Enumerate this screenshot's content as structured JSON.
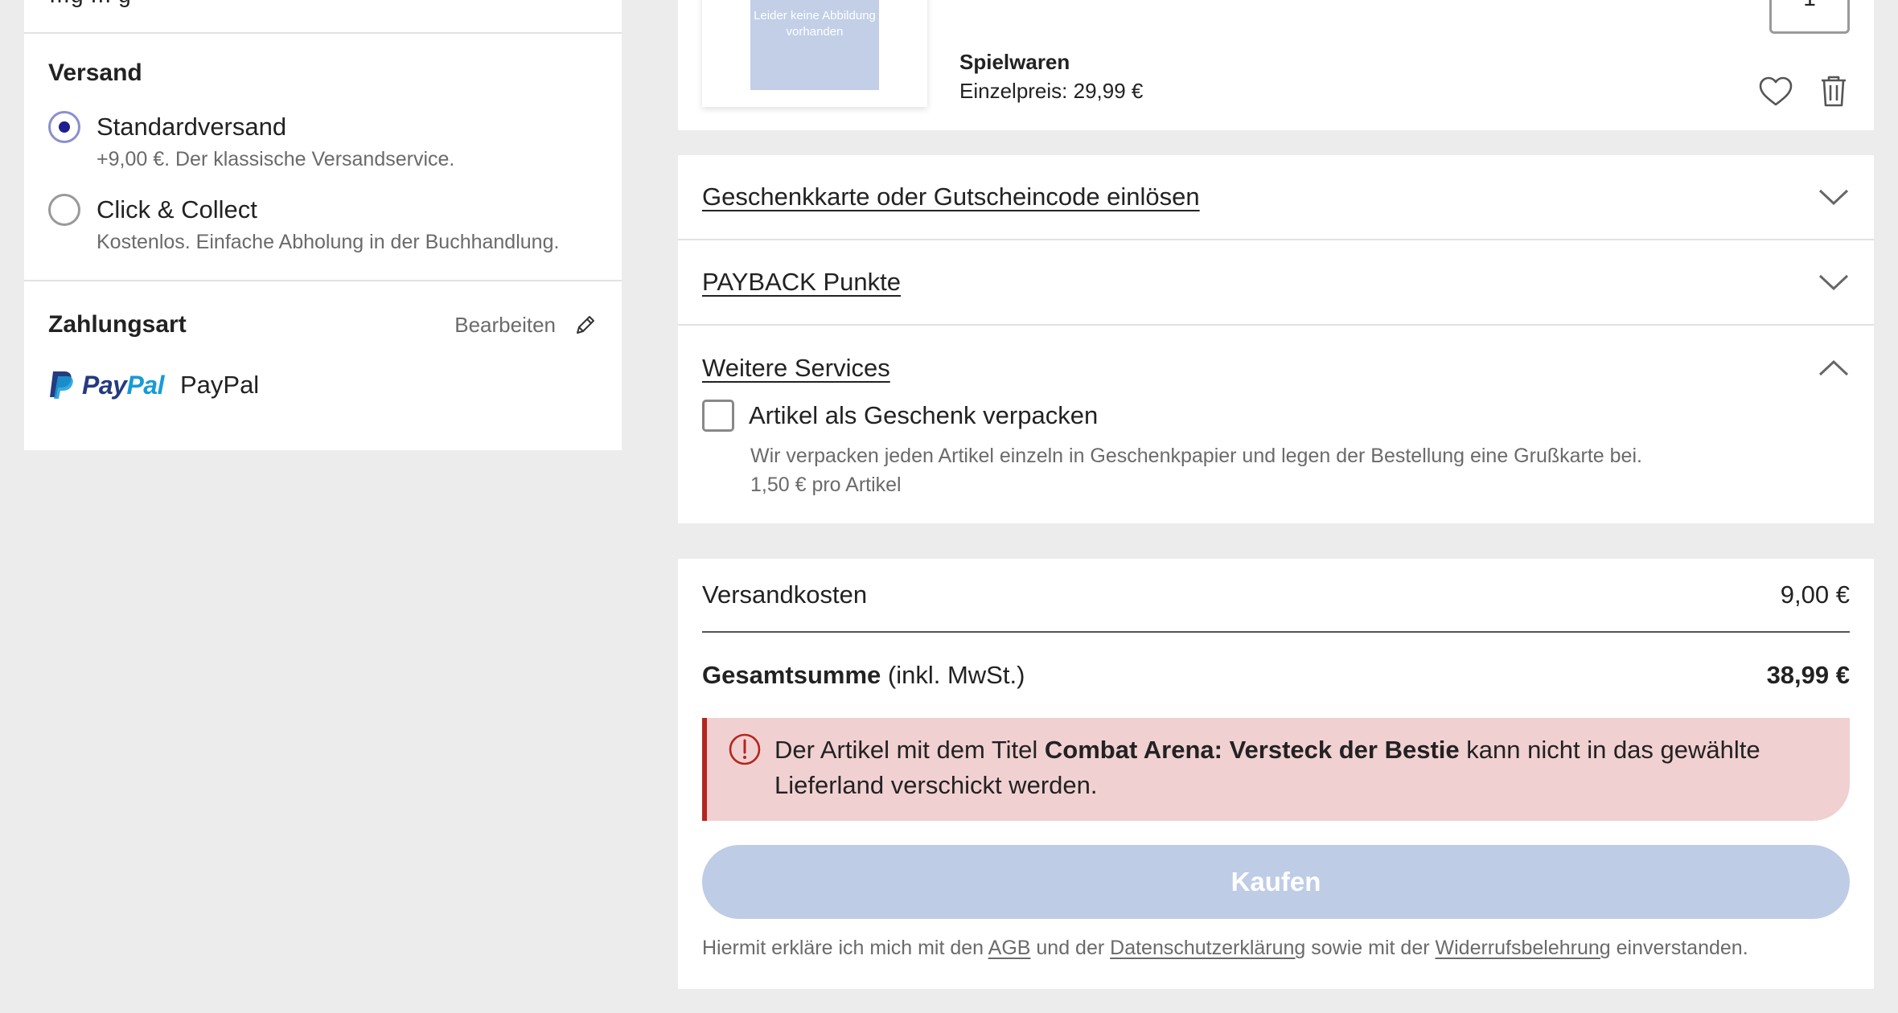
{
  "left": {
    "cut_text": "…g … g",
    "shipping": {
      "title": "Versand",
      "options": [
        {
          "label": "Standardversand",
          "description": "+9,00 €. Der klassische Versandservice.",
          "selected": true
        },
        {
          "label": "Click & Collect",
          "description": "Kostenlos. Einfache Abholung in der Buchhandlung.",
          "selected": false
        }
      ]
    },
    "payment": {
      "title": "Zahlungsart",
      "edit_label": "Bearbeiten",
      "logo_pay": "Pay",
      "logo_pal": "Pal",
      "method": "PayPal"
    }
  },
  "product": {
    "image_placeholder": "Leider keine Abbildung vorhanden",
    "category": "Spielwaren",
    "unit_price": "Einzelpreis: 29,99 €",
    "quantity": "1"
  },
  "accordion": {
    "voucher": "Geschenkkarte oder Gutscheincode einlösen",
    "payback": "PAYBACK Punkte",
    "services": "Weitere Services",
    "gift_wrap_label": "Artikel als Geschenk verpacken",
    "gift_wrap_desc": "Wir verpacken jeden Artikel einzeln in Geschenkpapier und legen der Bestellung eine Grußkarte bei.",
    "gift_wrap_price": "1,50 € pro Artikel"
  },
  "summary": {
    "shipping_label": "Versandkosten",
    "shipping_value": "9,00 €",
    "total_label": "Gesamtsumme",
    "total_note": " (inkl. MwSt.)",
    "total_value": "38,99 €",
    "error_pre": "Der Artikel mit dem Titel ",
    "error_title": "Combat Arena: Versteck der Bestie",
    "error_post": " kann nicht in das gewählte Lieferland verschickt werden.",
    "buy_label": "Kaufen",
    "legal_1": "Hiermit erkläre ich mich mit den ",
    "legal_agb": "AGB",
    "legal_2": " und der ",
    "legal_privacy": "Datenschutzerklärung",
    "legal_3": " sowie mit der ",
    "legal_withdrawal": "Widerrufsbelehrung",
    "legal_4": " einverstanden."
  },
  "colors": {
    "radio_selected": "#1f1f8f",
    "error_bg": "#f1d0d1",
    "error_accent": "#b3261e",
    "buy_disabled": "#bfcce6",
    "paypal_dark": "#253b80",
    "paypal_light": "#179bd7"
  },
  "icons": [
    "pencil-icon",
    "paypal-logo-icon",
    "heart-icon",
    "trash-icon",
    "chevron-down-icon",
    "chevron-up-icon",
    "error-icon"
  ]
}
